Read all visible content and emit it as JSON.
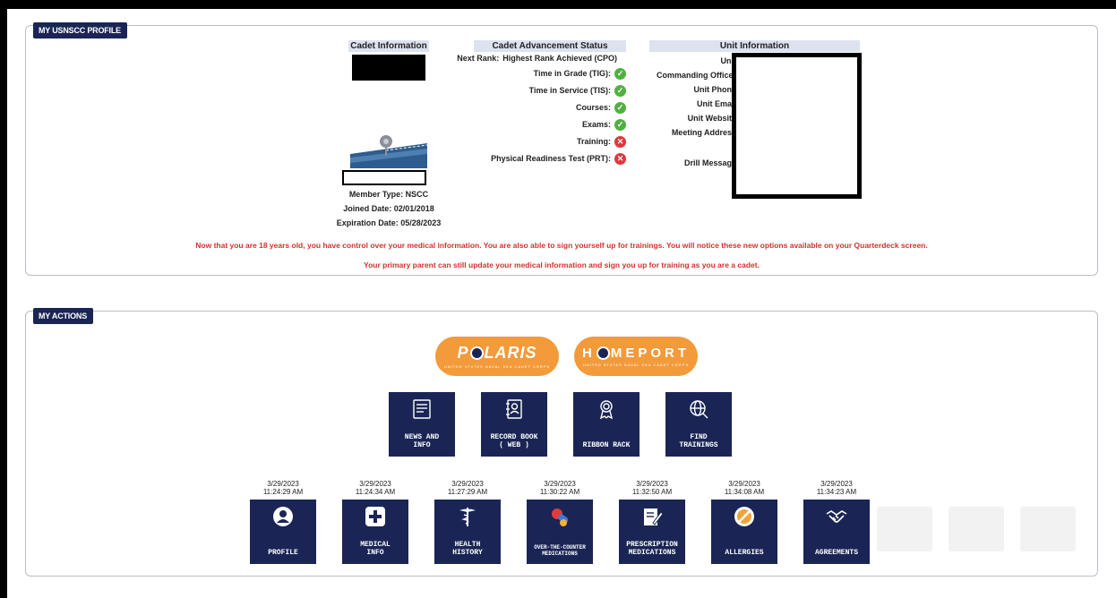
{
  "profile": {
    "tab_label": "MY USNSCC PROFILE",
    "cadet": {
      "header": "Cadet Information",
      "member_type": "Member Type: NSCC",
      "joined_date": "Joined Date: 02/01/2018",
      "expiration_date": "Expiration Date: 05/28/2023"
    },
    "advancement": {
      "header": "Cadet Advancement Status",
      "next_rank_label": "Next Rank:",
      "next_rank_value": "Highest Rank Achieved (CPO)",
      "items": [
        {
          "label": "Time in Grade (TIG):",
          "status": "complete"
        },
        {
          "label": "Time in Service (TIS):",
          "status": "complete"
        },
        {
          "label": "Courses:",
          "status": "complete"
        },
        {
          "label": "Exams:",
          "status": "complete"
        },
        {
          "label": "Training:",
          "status": "incomplete"
        },
        {
          "label": "Physical Readiness Test (PRT):",
          "status": "incomplete"
        }
      ]
    },
    "unit": {
      "header": "Unit Information",
      "unit_label": "Unit:",
      "commanding_officer_label": "Commanding Officer:",
      "phone_label": "Unit Phone:",
      "email_label": "Unit Email:",
      "website_label": "Unit Website:",
      "meeting_address_label": "Meeting Address:",
      "drill_message_label": "Drill Message:"
    },
    "notice_1": "Now that you are 18 years old, you have control over your medical information. You are also able to sign yourself up for trainings. You will notice these new options available on your Quarterdeck screen.",
    "notice_2": "Your primary parent can still update your medical information and sign you up for training as you are a cadet."
  },
  "actions": {
    "tab_label": "MY ACTIONS",
    "polaris": {
      "title_a": "P",
      "title_b": "LARIS",
      "subtitle": "UNITED STATES NAVAL SEA CADET CORPS"
    },
    "homeport": {
      "title_a": "H",
      "title_b": "MEPORT",
      "subtitle": "UNITED STATES NAVAL SEA CADET CORPS"
    },
    "quick_tiles": {
      "news": "NEWS AND\nINFO",
      "record_book": "RECORD BOOK\n( WEB )",
      "ribbon_rack": "RIBBON RACK",
      "find_trainings": "FIND\nTRAININGS"
    },
    "form_tiles": {
      "profile": {
        "label": "PROFILE",
        "date": "3/29/2023",
        "time": "11:24:29 AM"
      },
      "medical_info": {
        "label": "MEDICAL\nINFO",
        "date": "3/29/2023",
        "time": "11:24:34 AM"
      },
      "health_history": {
        "label": "HEALTH\nHISTORY",
        "date": "3/29/2023",
        "time": "11:27:29 AM"
      },
      "otc_medications": {
        "label": "OVER-THE-COUNTER\nMEDICATIONS",
        "date": "3/29/2023",
        "time": "11:30:22 AM"
      },
      "prescription_medications": {
        "label": "PRESCRIPTION\nMEDICATIONS",
        "date": "3/29/2023",
        "time": "11:32:50 AM"
      },
      "allergies": {
        "label": "ALLERGIES",
        "date": "3/29/2023",
        "time": "11:34:08 AM"
      },
      "agreements": {
        "label": "AGREEMENTS",
        "date": "3/29/2023",
        "time": "11:34:23 AM"
      }
    }
  },
  "colors": {
    "navy": "#1a2555",
    "orange": "#f39a3a",
    "alert_red": "#d4312b",
    "success_green": "#52b043",
    "failure_red": "#e0363c"
  }
}
